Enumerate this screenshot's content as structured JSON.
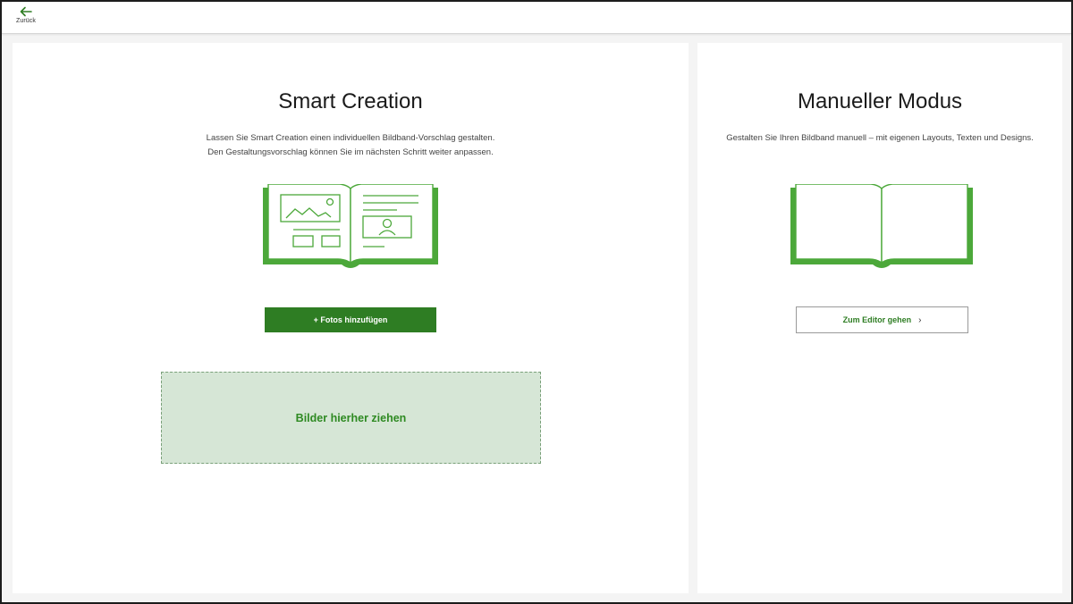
{
  "header": {
    "back_label": "Zurück",
    "back_icon": "arrow-left-icon"
  },
  "smart": {
    "title": "Smart Creation",
    "desc_line1": "Lassen Sie Smart Creation einen individuellen Bildband-Vorschlag gestalten.",
    "desc_line2": "Den Gestaltungsvorschlag können Sie im nächsten Schritt weiter anpassen.",
    "add_photos_label": "+ Fotos hinzufügen",
    "dropzone_label": "Bilder hierher ziehen",
    "illustration_icon": "photo-book-layout-icon"
  },
  "manual": {
    "title": "Manueller Modus",
    "desc": "Gestalten Sie Ihren Bildband manuell – mit eigenen Layouts, Texten und Designs.",
    "editor_label": "Zum Editor gehen",
    "editor_chevron": "›",
    "illustration_icon": "blank-book-icon"
  },
  "colors": {
    "accent": "#2e7d23",
    "illustration": "#4ca83a",
    "dropzone_bg": "#d6e6d6"
  }
}
